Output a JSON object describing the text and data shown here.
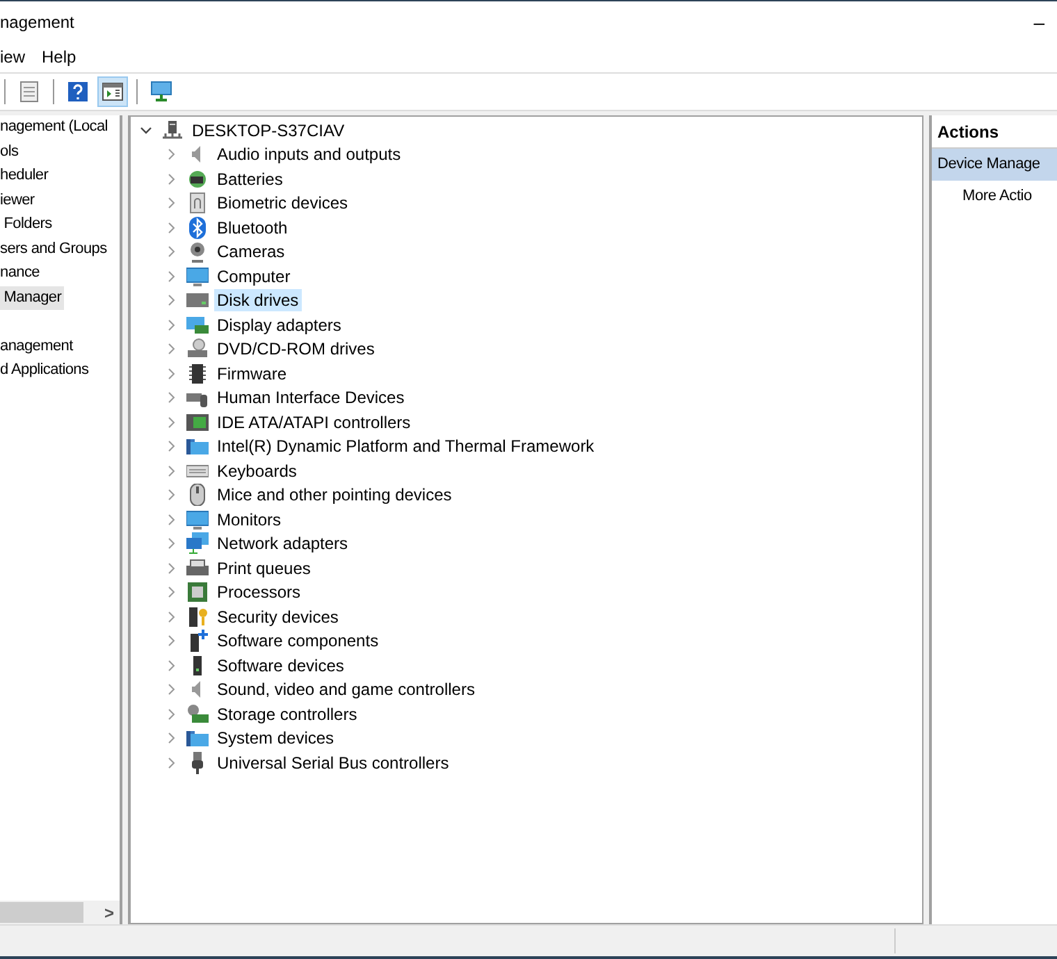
{
  "window": {
    "title": "nagement",
    "minimize": "–"
  },
  "menu": [
    {
      "label": "iew"
    },
    {
      "label": "Help"
    }
  ],
  "toolbar": [
    {
      "kind": "properties",
      "pressed": false
    },
    {
      "kind": "help",
      "pressed": false
    },
    {
      "kind": "console",
      "pressed": true
    },
    {
      "kind": "monitor",
      "pressed": false
    }
  ],
  "sidebar": {
    "groups": [
      {
        "items": [
          {
            "label": "nagement (Local",
            "selected": false
          },
          {
            "label": "ols",
            "selected": false
          },
          {
            "label": "heduler",
            "selected": false
          },
          {
            "label": "iewer",
            "selected": false
          },
          {
            "label": " Folders",
            "selected": false
          },
          {
            "label": "sers and Groups",
            "selected": false
          },
          {
            "label": "nance",
            "selected": false
          },
          {
            "label": " Manager",
            "selected": true
          }
        ]
      },
      {
        "items": [
          {
            "label": "anagement",
            "selected": false
          },
          {
            "label": "d Applications",
            "selected": false
          }
        ]
      }
    ],
    "scroll_arrow": ">"
  },
  "device_tree": {
    "root": {
      "label": "DESKTOP-S37CIAV",
      "expanded": true,
      "children": [
        {
          "label": "Audio inputs and outputs",
          "expanded": false,
          "selected": false
        },
        {
          "label": "Batteries",
          "expanded": false,
          "selected": false
        },
        {
          "label": "Biometric devices",
          "expanded": false,
          "selected": false
        },
        {
          "label": "Bluetooth",
          "expanded": false,
          "selected": false
        },
        {
          "label": "Cameras",
          "expanded": false,
          "selected": false
        },
        {
          "label": "Computer",
          "expanded": false,
          "selected": false
        },
        {
          "label": "Disk drives",
          "expanded": false,
          "selected": true
        },
        {
          "label": "Display adapters",
          "expanded": false,
          "selected": false
        },
        {
          "label": "DVD/CD-ROM drives",
          "expanded": false,
          "selected": false
        },
        {
          "label": "Firmware",
          "expanded": false,
          "selected": false
        },
        {
          "label": "Human Interface Devices",
          "expanded": false,
          "selected": false
        },
        {
          "label": "IDE ATA/ATAPI controllers",
          "expanded": false,
          "selected": false
        },
        {
          "label": "Intel(R) Dynamic Platform and Thermal Framework",
          "expanded": false,
          "selected": false
        },
        {
          "label": "Keyboards",
          "expanded": false,
          "selected": false
        },
        {
          "label": "Mice and other pointing devices",
          "expanded": false,
          "selected": false
        },
        {
          "label": "Monitors",
          "expanded": false,
          "selected": false
        },
        {
          "label": "Network adapters",
          "expanded": false,
          "selected": false
        },
        {
          "label": "Print queues",
          "expanded": false,
          "selected": false
        },
        {
          "label": "Processors",
          "expanded": false,
          "selected": false
        },
        {
          "label": "Security devices",
          "expanded": false,
          "selected": false
        },
        {
          "label": "Software components",
          "expanded": false,
          "selected": false
        },
        {
          "label": "Software devices",
          "expanded": false,
          "selected": false
        },
        {
          "label": "Sound, video and game controllers",
          "expanded": false,
          "selected": false
        },
        {
          "label": "Storage controllers",
          "expanded": false,
          "selected": false
        },
        {
          "label": "System devices",
          "expanded": false,
          "selected": false
        },
        {
          "label": "Universal Serial Bus controllers",
          "expanded": false,
          "selected": false
        }
      ]
    }
  },
  "actions": {
    "title": "Actions",
    "items": [
      {
        "label": "Device Manage",
        "kind": "header",
        "selected": true
      },
      {
        "label": "More Actio",
        "kind": "sub",
        "selected": false
      }
    ]
  }
}
